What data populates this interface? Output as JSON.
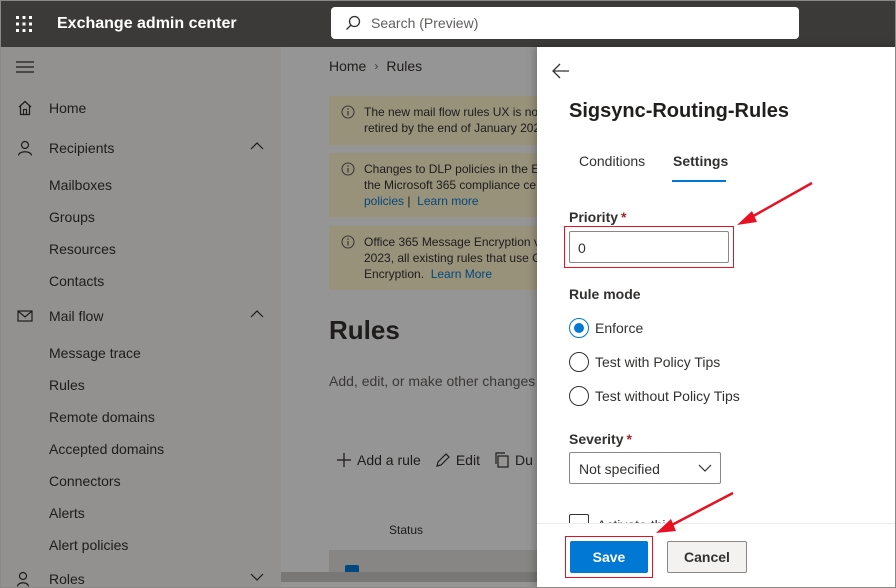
{
  "app": {
    "title": "Exchange admin center"
  },
  "search": {
    "placeholder": "Search (Preview)"
  },
  "nav": {
    "items": [
      {
        "label": "Home"
      },
      {
        "label": "Recipients"
      },
      {
        "label": "Mail flow"
      },
      {
        "label": "Roles"
      }
    ],
    "recipients_sub": [
      "Mailboxes",
      "Groups",
      "Resources",
      "Contacts"
    ],
    "mailflow_sub": [
      "Message trace",
      "Rules",
      "Remote domains",
      "Accepted domains",
      "Connectors",
      "Alerts",
      "Alert policies"
    ]
  },
  "breadcrumb": {
    "home": "Home",
    "current": "Rules"
  },
  "banners": [
    {
      "line1": "The new mail flow rules UX is no",
      "line2": "retired by the end of January 202"
    },
    {
      "line1": "Changes to DLP policies in the Ex",
      "line2": "the Microsoft 365 compliance ce",
      "link1": "policies",
      "sep": "|",
      "link2": "Learn more"
    },
    {
      "line1": "Office 365 Message Encryption v",
      "line2": "2023, all existing rules that use C",
      "line3": "Encryption.",
      "link": "Learn More"
    }
  ],
  "main": {
    "title": "Rules",
    "description": "Add, edit, or make other changes",
    "toolbar": {
      "add": "Add a rule",
      "edit": "Edit",
      "dup": "Du"
    },
    "column_status": "Status"
  },
  "panel": {
    "title": "Sigsync-Routing-Rules",
    "tabs": [
      {
        "label": "Conditions"
      },
      {
        "label": "Settings"
      }
    ],
    "active_tab": "Settings",
    "priority": {
      "label": "Priority",
      "required": "*",
      "value": "0"
    },
    "rule_mode": {
      "label": "Rule mode",
      "options": [
        {
          "label": "Enforce",
          "selected": true
        },
        {
          "label": "Test with Policy Tips"
        },
        {
          "label": "Test without Policy Tips"
        }
      ]
    },
    "severity": {
      "label": "Severity",
      "required": "*",
      "value": "Not specified"
    },
    "activate_peek": "Activate this rule",
    "save": "Save",
    "cancel": "Cancel"
  },
  "colors": {
    "accent": "#0078d4",
    "topbar": "#3b3a39",
    "highlight": "#e81123",
    "banner": "#fff4ce"
  }
}
